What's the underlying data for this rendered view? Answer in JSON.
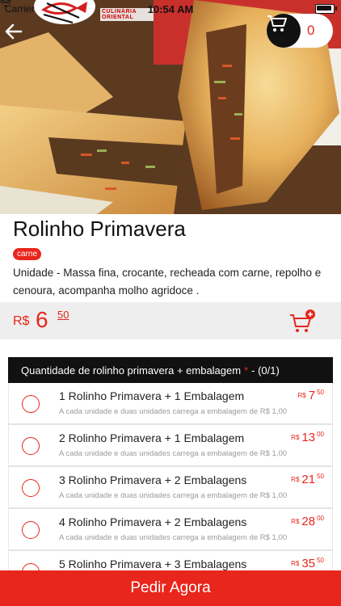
{
  "status_bar": {
    "carrier": "Carrier",
    "time": "10:54 AM"
  },
  "brand": {
    "subtitle": "CULINÁRIA ORIENTAL"
  },
  "cart": {
    "count": "0"
  },
  "product": {
    "title": "Rolinho Primavera",
    "tag": "carne",
    "description": "Unidade - Massa fina, crocante, recheada com carne, repolho e cenoura, acompanha molho agridoce .",
    "price": {
      "currency": "R$",
      "integer": "6",
      "decimal": "50"
    }
  },
  "options_group": {
    "title": "Quantidade de rolinho primavera + embalagem",
    "required_mark": "*",
    "counter": "- (0/1)",
    "items": [
      {
        "name": "1 Rolinho Primavera + 1 Embalagem",
        "note": "A cada unidade e duas unidades carrega a embalagem de R$ 1,00",
        "currency": "R$",
        "integer": "7",
        "decimal": "50"
      },
      {
        "name": "2 Rolinho Primavera + 1 Embalagem",
        "note": "A cada unidade e duas unidades carrega a embalagem de R$ 1,00",
        "currency": "R$",
        "integer": "13",
        "decimal": "00"
      },
      {
        "name": "3 Rolinho Primavera + 2 Embalagens",
        "note": "A cada unidade e duas unidades carrega a embalagem de R$ 1,00",
        "currency": "R$",
        "integer": "21",
        "decimal": "50"
      },
      {
        "name": "4 Rolinho Primavera + 2 Embalagens",
        "note": "A cada unidade e duas unidades carrega a embalagem de R$ 1,00",
        "currency": "R$",
        "integer": "28",
        "decimal": "00"
      },
      {
        "name": "5 Rolinho Primavera + 3 Embalagens",
        "note": "",
        "currency": "R$",
        "integer": "35",
        "decimal": "50"
      }
    ]
  },
  "footer": {
    "order_label": "Pedir Agora"
  },
  "colors": {
    "accent": "#e8261c",
    "dark": "#111111",
    "price_bar": "#eeeeee"
  },
  "icons": [
    "back-arrow-icon",
    "cart-icon",
    "add-to-cart-icon",
    "radio-icon",
    "battery-icon",
    "wifi-icon",
    "logo-fish"
  ]
}
